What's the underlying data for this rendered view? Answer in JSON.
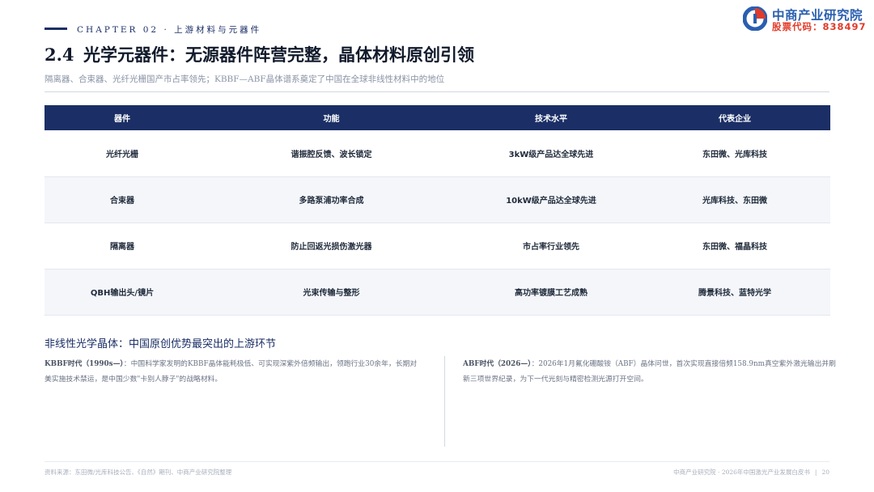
{
  "header": {
    "chapter": "CHAPTER 02 · 上游材料与元器件",
    "logo": {
      "name": "中商产业研究院",
      "stock_code": "股票代码：838497"
    }
  },
  "title": {
    "number": "2.4",
    "text": "光学元器件：无源器件阵营完整，晶体材料原创引领"
  },
  "subtitle": "隔离器、合束器、光纤光栅国产市占率领先；KBBF—ABF晶体谱系奠定了中国在全球非线性材料中的地位",
  "table": {
    "headers": [
      "器件",
      "功能",
      "技术水平",
      "代表企业"
    ],
    "rows": [
      [
        "光纤光栅",
        "谐振腔反馈、波长锁定",
        "3kW级产品达全球先进",
        "东田微、光库科技"
      ],
      [
        "合束器",
        "多路泵浦功率合成",
        "10kW级产品达全球先进",
        "光库科技、东田微"
      ],
      [
        "隔离器",
        "防止回返光损伤激光器",
        "市占率行业领先",
        "东田微、福晶科技"
      ],
      [
        "QBH输出头/镜片",
        "光束传输与整形",
        "高功率镀膜工艺成熟",
        "腾景科技、蓝特光学"
      ]
    ]
  },
  "section": {
    "title": "非线性光学晶体：中国原创优势最突出的上游环节",
    "left": {
      "lead": "KBBF时代（1990s—）",
      "body": "：中国科学家发明的KBBF晶体能耗极低、可实现深紫外倍频输出，领跑行业30余年，长期对美实施技术禁运，是中国少数\"卡别人脖子\"的战略材料。"
    },
    "right": {
      "lead": "ABF时代（2026—）",
      "body": "：2026年1月氟化硼酸铵（ABF）晶体问世，首次实现直接倍频158.9nm真空紫外激光输出并刷新三项世界纪录，为下一代光刻与精密检测光源打开空间。"
    }
  },
  "footer": {
    "source": "资料来源：东田微/光库科技公告、《自然》期刊、中商产业研究院整理",
    "org": "中商产业研究院 · 2026年中国激光产业发展白皮书",
    "separator": "|",
    "page": "20"
  },
  "colors": {
    "navy": "#1b2f66",
    "logo_blue": "#2a5fb0",
    "logo_red": "#e23b2a"
  }
}
